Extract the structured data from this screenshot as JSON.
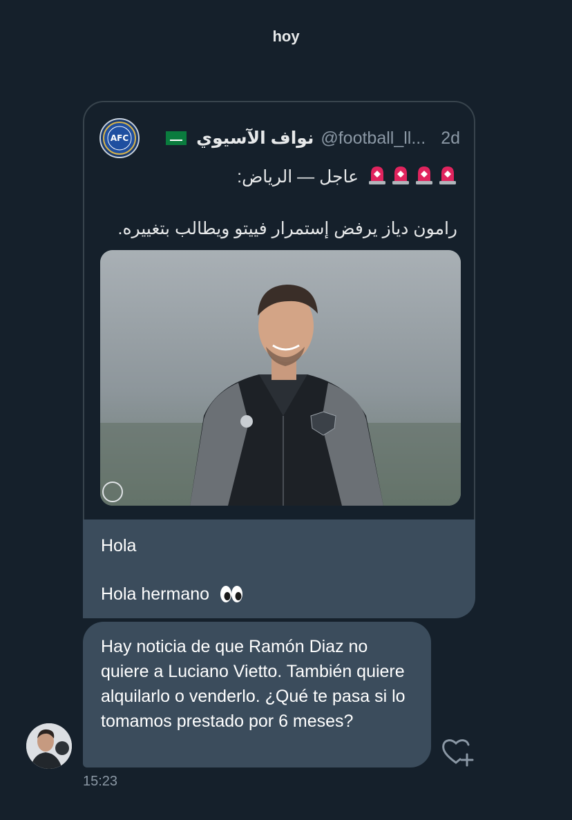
{
  "day_label": "hoy",
  "quoted_tweet": {
    "author_name": "نواف الآسيوي",
    "author_handle": "@football_ll...",
    "time": "2d",
    "line1_text": "عاجل — الرياض:",
    "line2_text": "رامون دياز يرفض إستمرار فييتو ويطالب بتغييره.",
    "siren_count": 4,
    "avatar_icon": "afc-logo-icon",
    "flag_icon": "saudi-flag-icon",
    "image": "football-player-photo",
    "colors": {
      "siren": "#e0245e",
      "flag": "#0a7c3e"
    }
  },
  "messages": {
    "quote_reply_line1": "Hola",
    "quote_reply_line2": "Hola hermano",
    "main_text": "Hay noticia de que Ramón Diaz no quiere a Luciano Vietto. También quiere alquilarlo o venderlo. ¿Qué te pasa si lo tomamos prestado por 6 meses?",
    "timestamp": "15:23"
  },
  "icons": {
    "eyes": "eyes-emoji-icon",
    "like": "heart-plus-icon"
  },
  "colors": {
    "background": "#15202b",
    "bubble": "#3b4c5c",
    "card_border": "#38444d",
    "muted_text": "#8b98a5"
  }
}
